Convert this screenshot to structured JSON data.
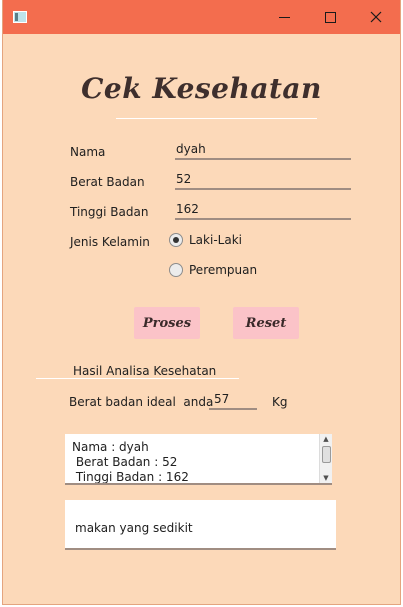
{
  "app": {
    "title": "Cek Kesehatan"
  },
  "form": {
    "nama_label": "Nama",
    "nama_value": "dyah",
    "berat_label": "Berat Badan",
    "berat_value": "52",
    "tinggi_label": "Tinggi Badan",
    "tinggi_value": "162",
    "gender_label": "Jenis Kelamin",
    "gender_options": [
      {
        "label": "Laki-Laki",
        "checked": true
      },
      {
        "label": "Perempuan",
        "checked": false
      }
    ]
  },
  "buttons": {
    "proses": "Proses",
    "reset": "Reset"
  },
  "results": {
    "section_title": "Hasil Analisa Kesehatan",
    "ideal_label": "Berat badan ideal  anda",
    "ideal_value": "57",
    "ideal_unit": "Kg",
    "summary_lines": [
      "Nama : dyah",
      " Berat Badan : 52",
      " Tinggi Badan : 162"
    ],
    "advice": "makan yang sedikit"
  }
}
